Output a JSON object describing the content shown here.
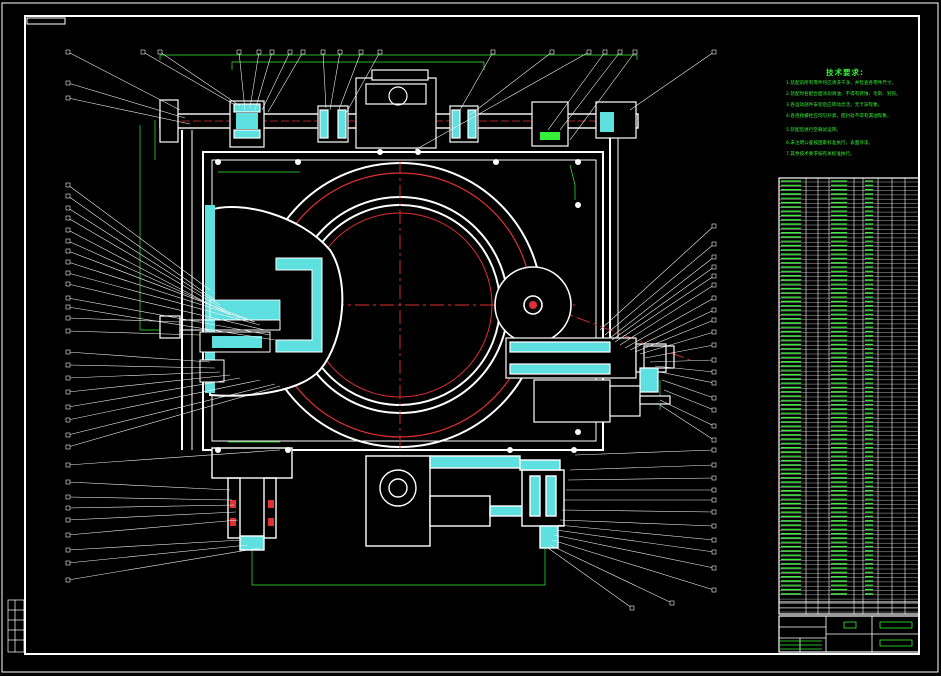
{
  "drawing": {
    "tech_requirements_title": "技术要求:",
    "tech_notes": [
      "1.装配前所有零件均应清洗干净，并检查各零件尺寸。",
      "2.装配时各配合面涂润滑油，不得有锈蚀、毛刺、划伤。",
      "3.各运动部件安装后应转动灵活，无卡滞现象。",
      "4.各连接螺栓应均匀拧紧，密封处不得有漏油现象。",
      "5.装配后进行空载试运转。",
      "6.未注明公差按国家标准执行，表面涂漆。",
      "7.其余技术要求按有关标准执行。"
    ]
  },
  "colors": {
    "background": "#000000",
    "outline": "#ffffff",
    "section_fill": "#5fe0e0",
    "center_line": "#e03030",
    "leader": "#f0f0f0",
    "dimension": "#35f035",
    "text": "#35f035"
  }
}
